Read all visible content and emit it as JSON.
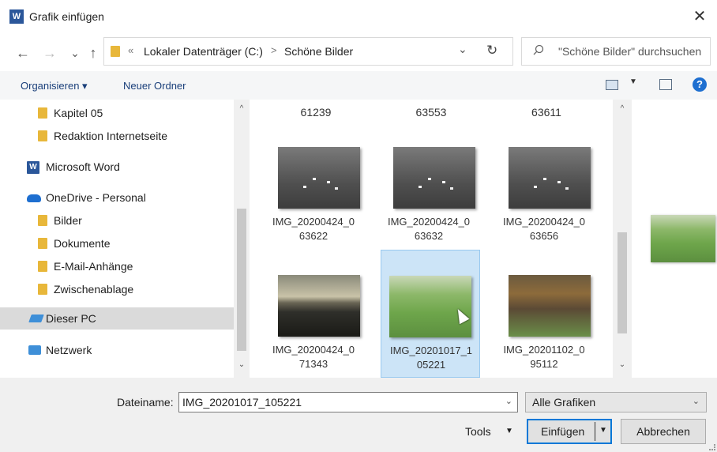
{
  "window": {
    "title": "Grafik einfügen",
    "close_glyph": "✕"
  },
  "nav_buttons": {
    "back": "←",
    "forward": "→",
    "recent": "⌄",
    "up": "↑"
  },
  "address": {
    "overflow": "«",
    "crumbs": [
      "Lokaler Datenträger (C:)",
      "Schöne Bilder"
    ],
    "separator": ">",
    "dropdown": "⌄",
    "refresh": "↻"
  },
  "search": {
    "icon": "search-icon",
    "placeholder": "\"Schöne Bilder\" durchsuchen"
  },
  "toolbar": {
    "organize": "Organisieren ▾",
    "new_folder": "Neuer Ordner",
    "help": "?"
  },
  "navpane": {
    "items": [
      {
        "label": "Kapitel 05",
        "icon": "folder-icon"
      },
      {
        "label": "Redaktion Internetseite",
        "icon": "folder-icon"
      },
      {
        "label": "Microsoft Word",
        "icon": "word-icon"
      },
      {
        "label": "OneDrive - Personal",
        "icon": "onedrive-icon"
      },
      {
        "label": "Bilder",
        "icon": "folder-icon"
      },
      {
        "label": "Dokumente",
        "icon": "folder-icon"
      },
      {
        "label": "E-Mail-Anhänge",
        "icon": "folder-icon"
      },
      {
        "label": "Zwischenablage",
        "icon": "folder-icon"
      },
      {
        "label": "Dieser PC",
        "icon": "this-pc-icon",
        "selected": true
      },
      {
        "label": "Netzwerk",
        "icon": "network-icon"
      }
    ],
    "word_letter": "W"
  },
  "files": {
    "top_row": [
      "61239",
      "63553",
      "63611"
    ],
    "tiles": [
      {
        "line1": "IMG_20200424_0",
        "line2": "63622",
        "thumb": "swans"
      },
      {
        "line1": "IMG_20200424_0",
        "line2": "63632",
        "thumb": "swans"
      },
      {
        "line1": "IMG_20200424_0",
        "line2": "63656",
        "thumb": "swans"
      },
      {
        "line1": "IMG_20200424_0",
        "line2": "71343",
        "thumb": "sunset-lake"
      },
      {
        "line1": "IMG_20201017_1",
        "line2": "05221",
        "thumb": "deer-meadow",
        "selected": true
      },
      {
        "line1": "IMG_20201102_0",
        "line2": "95112",
        "thumb": "horses-autumn"
      }
    ]
  },
  "scroll": {
    "up": "^",
    "down": "⌄"
  },
  "bottom": {
    "filename_label": "Dateiname:",
    "filename_value": "IMG_20201017_105221",
    "filter_value": "Alle Grafiken",
    "tools_label": "Tools",
    "tools_dd": "▼",
    "insert_label": "Einfügen",
    "insert_dd": "▼",
    "cancel_label": "Abbrechen",
    "combo_dd": "⌄"
  }
}
